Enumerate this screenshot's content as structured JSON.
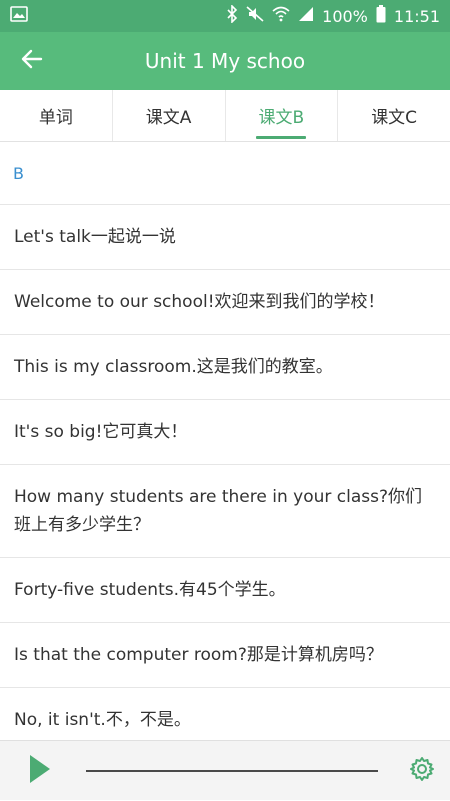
{
  "status_bar": {
    "battery": "100%",
    "time": "11:51",
    "icons": [
      "image-icon",
      "bluetooth-icon",
      "mute-icon",
      "wifi-icon",
      "signal-icon",
      "battery-icon"
    ]
  },
  "app_bar": {
    "title": "Unit 1 My schoo",
    "back_icon": "arrow-left-icon"
  },
  "tabs": [
    {
      "label": "单词",
      "active": false
    },
    {
      "label": "课文A",
      "active": false
    },
    {
      "label": "课文B",
      "active": true
    },
    {
      "label": "课文C",
      "active": false
    }
  ],
  "content": {
    "section_label": "B",
    "sentences": [
      "Let's talk一起说一说",
      "Welcome to our school!欢迎来到我们的学校！",
      "This is my classroom.这是我们的教室。",
      "It's so big!它可真大！",
      "How many students are there in your class?你们班上有多少学生？",
      "Forty-five students.有45个学生。",
      "Is that the computer room?那是计算机房吗？",
      "No, it isn't.不，不是。"
    ]
  },
  "player": {
    "play_icon": "play-icon",
    "settings_icon": "gear-icon"
  },
  "colors": {
    "status_bar": "#4cab73",
    "app_bar": "#57bb7c",
    "accent": "#4cab73",
    "section_label": "#3a8fcf"
  }
}
